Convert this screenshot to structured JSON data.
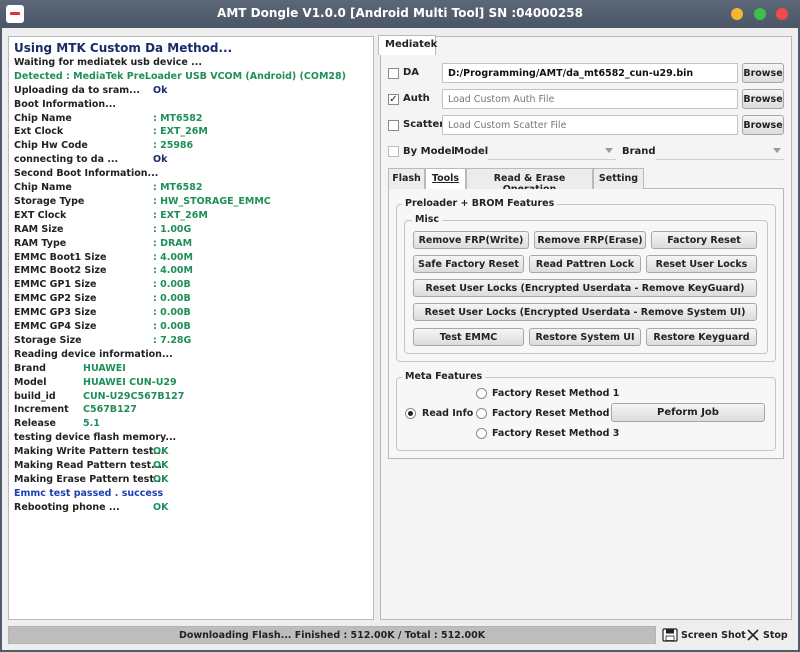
{
  "window": {
    "title": "AMT Dongle V1.0.0 [Android Multi Tool] SN :04000258"
  },
  "log": [
    {
      "text": "Using MTK Custom Da Method...",
      "style": "heading"
    },
    {
      "text": "Waiting for mediatek usb device ..."
    },
    {
      "text": "Detected   :   MediaTek PreLoader USB VCOM (Android) (COM28)",
      "style": "green"
    },
    {
      "text": "Uploading da to sram...",
      "value": "Ok",
      "value_style": "navy"
    },
    {
      "text": "Boot Information..."
    },
    {
      "text": "Chip Name",
      "value": ": MT6582",
      "value_style": "green"
    },
    {
      "text": "Ext Clock",
      "value": ": EXT_26M",
      "value_style": "green"
    },
    {
      "text": "Chip Hw Code",
      "value": ": 25986",
      "value_style": "green"
    },
    {
      "text": "connecting to da ...",
      "value": "Ok",
      "value_style": "navy"
    },
    {
      "text": "Second Boot Information..."
    },
    {
      "text": "Chip Name",
      "value": ": MT6582",
      "value_style": "green"
    },
    {
      "text": "Storage Type",
      "value": ": HW_STORAGE_EMMC",
      "value_style": "green"
    },
    {
      "text": "EXT Clock",
      "value": ": EXT_26M",
      "value_style": "green"
    },
    {
      "text": "RAM Size",
      "value": ": 1.00G",
      "value_style": "green"
    },
    {
      "text": "RAM Type",
      "value": ": DRAM",
      "value_style": "green"
    },
    {
      "text": "EMMC Boot1 Size",
      "value": ": 4.00M",
      "value_style": "green"
    },
    {
      "text": "EMMC Boot2 Size",
      "value": ": 4.00M",
      "value_style": "green"
    },
    {
      "text": "EMMC GP1 Size",
      "value": ": 0.00B",
      "value_style": "green"
    },
    {
      "text": "EMMC GP2 Size",
      "value": ": 0.00B",
      "value_style": "green"
    },
    {
      "text": "EMMC GP3 Size",
      "value": ": 0.00B",
      "value_style": "green"
    },
    {
      "text": "EMMC GP4 Size",
      "value": ": 0.00B",
      "value_style": "green"
    },
    {
      "text": "Storage Size",
      "value": ": 7.28G",
      "value_style": "green"
    },
    {
      "text": "Reading device information..."
    },
    {
      "text": "Brand",
      "value": "HUAWEI",
      "value_style": "green",
      "value_col": "short"
    },
    {
      "text": "Model",
      "value": "HUAWEI CUN-U29",
      "value_style": "green",
      "value_col": "short"
    },
    {
      "text": "build_id",
      "value": "CUN-U29C567B127",
      "value_style": "green",
      "value_col": "short"
    },
    {
      "text": "Increment",
      "value": "C567B127",
      "value_style": "green",
      "value_col": "short"
    },
    {
      "text": "Release",
      "value": "5.1",
      "value_style": "green",
      "value_col": "short"
    },
    {
      "text": "testing device flash memory..."
    },
    {
      "text": "Making Write Pattern test...",
      "value": "OK",
      "value_style": "green"
    },
    {
      "text": "Making Read Pattern test...",
      "value": "OK",
      "value_style": "green"
    },
    {
      "text": "Making Erase Pattern test...",
      "value": "OK",
      "value_style": "green"
    },
    {
      "text": "Emmc test passed . success",
      "style": "blue"
    },
    {
      "text": "Rebooting phone ...",
      "value": "OK",
      "value_style": "green"
    }
  ],
  "main_tab": "Mediatek",
  "files": {
    "da": {
      "label": "DA",
      "checked": false,
      "value": "D:/Programming/AMT/da_mt6582_cun-u29.bin",
      "placeholder": ""
    },
    "auth": {
      "label": "Auth",
      "checked": true,
      "value": "",
      "placeholder": "Load Custom Auth File"
    },
    "scatter": {
      "label": "Scatter",
      "checked": false,
      "value": "",
      "placeholder": "Load Custom Scatter File"
    },
    "browse_label": "Browse"
  },
  "model_row": {
    "by_model_label": "By Model",
    "model_label": "Model",
    "brand_label": "Brand"
  },
  "subtabs": [
    {
      "label": "Flash",
      "active": false
    },
    {
      "label": "Tools",
      "active": true
    },
    {
      "label": "Read & Erase Operation",
      "active": false
    },
    {
      "label": "Setting",
      "active": false
    }
  ],
  "preloader": {
    "title": "Preloader + BROM Features",
    "misc_title": "Misc",
    "buttons": {
      "remove_frp_write": "Remove FRP(Write)",
      "remove_frp_erase": "Remove FRP(Erase)",
      "factory_reset": "Factory Reset",
      "safe_factory_reset": "Safe Factory Reset",
      "read_pattern_lock": "Read Pattren Lock",
      "reset_user_locks": "Reset User Locks",
      "reset_user_locks_keyguard": "Reset User Locks (Encrypted Userdata - Remove KeyGuard)",
      "reset_user_locks_systemui": "Reset User Locks (Encrypted Userdata - Remove System UI)",
      "test_emmc": "Test EMMC",
      "restore_system_ui": "Restore System UI",
      "restore_keyguard": "Restore Keyguard"
    }
  },
  "meta": {
    "title": "Meta Features",
    "read_info": "Read Info",
    "method1": "Factory Reset Method 1",
    "method2": "Factory Reset Method 2",
    "method3": "Factory Reset Method 3",
    "perform_job": "Peform Job",
    "selected": "read_info"
  },
  "status": {
    "progress_text": "Downloading Flash... Finished : 512.00K / Total : 512.00K",
    "progress_fraction": 1.0,
    "screenshot_label": "Screen Shot",
    "stop_label": "Stop"
  }
}
